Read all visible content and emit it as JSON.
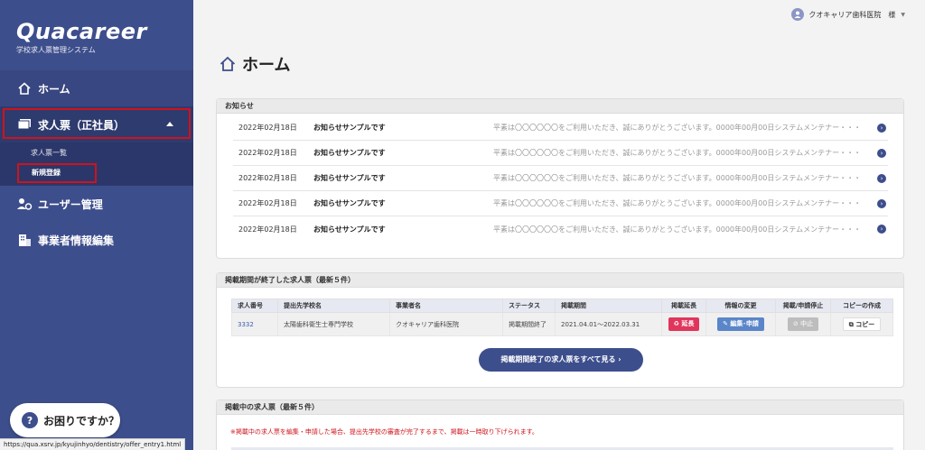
{
  "sidebar": {
    "logo_title": "Quacareer",
    "logo_sub": "学校求人票管理システム",
    "home_label": "ホーム",
    "offers_label": "求人票（正社員）",
    "offers_sub": [
      "求人票一覧",
      "新規登録"
    ],
    "users_label": "ユーザー管理",
    "biz_label": "事業者情報編集",
    "help_label": "お困りですか？",
    "status_url": "https://qua.xsrv.jp/kyujinhyo/dentistry/offer_entry1.html"
  },
  "header": {
    "user_name": "クオキャリア歯科医院　様"
  },
  "main": {
    "title": "ホーム",
    "news": {
      "heading": "お知らせ",
      "items": [
        {
          "date": "2022年02月18日",
          "title": "お知らせサンプルです",
          "body": "平素は〇〇〇〇〇〇をご利用いただき、誠にありがとうございます。0000年00月00日システムメンテナー・・・"
        },
        {
          "date": "2022年02月18日",
          "title": "お知らせサンプルです",
          "body": "平素は〇〇〇〇〇〇をご利用いただき、誠にありがとうございます。0000年00月00日システムメンテナー・・・"
        },
        {
          "date": "2022年02月18日",
          "title": "お知らせサンプルです",
          "body": "平素は〇〇〇〇〇〇をご利用いただき、誠にありがとうございます。0000年00月00日システムメンテナー・・・"
        },
        {
          "date": "2022年02月18日",
          "title": "お知らせサンプルです",
          "body": "平素は〇〇〇〇〇〇をご利用いただき、誠にありがとうございます。0000年00月00日システムメンテナー・・・"
        },
        {
          "date": "2022年02月18日",
          "title": "お知らせサンプルです",
          "body": "平素は〇〇〇〇〇〇をご利用いただき、誠にありがとうございます。0000年00月00日システムメンテナー・・・"
        }
      ]
    },
    "expired": {
      "heading": "掲載期間が終了した求人票（最新５件）",
      "columns": [
        "求人番号",
        "提出先学校名",
        "事業者名",
        "ステータス",
        "掲載期間",
        "掲載延長",
        "情報の変更",
        "掲載/申請停止",
        "コピーの作成"
      ],
      "row": {
        "id": "3332",
        "school": "太陽歯科衛生士専門学校",
        "company": "クオキャリア歯科医院",
        "status": "掲載期間終了",
        "period": "2021.04.01～2022.03.31",
        "extend": "延長",
        "edit": "編集･申請",
        "stop": "中止",
        "copy": "コピー"
      },
      "see_all": "掲載期間終了の求人票をすべて見る ›"
    },
    "active": {
      "heading": "掲載中の求人票（最新５件）",
      "warning": "※掲載中の求人票を編集・申請した場合、提出先学校の審査が完了するまで、掲載は一時取り下げられます。"
    }
  }
}
